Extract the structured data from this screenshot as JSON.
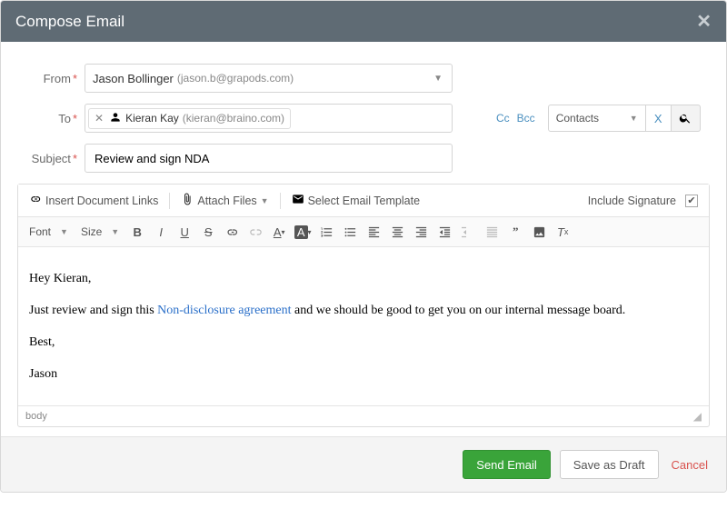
{
  "header": {
    "title": "Compose Email"
  },
  "labels": {
    "from": "From",
    "to": "To",
    "subject": "Subject"
  },
  "from": {
    "name": "Jason Bollinger",
    "email": "(jason.b@grapods.com)"
  },
  "to": {
    "chips": [
      {
        "name": "Kieran Kay",
        "email": "(kieran@braino.com)"
      }
    ],
    "cc_label": "Cc",
    "bcc_label": "Bcc",
    "contacts_label": "Contacts"
  },
  "subject": {
    "value": "Review and sign NDA"
  },
  "toolbar1": {
    "insert_links": "Insert Document Links",
    "attach_files": "Attach Files",
    "select_template": "Select Email Template",
    "include_signature": "Include Signature",
    "signature_checked": true
  },
  "toolbar2": {
    "font_label": "Font",
    "size_label": "Size"
  },
  "body": {
    "greeting": "Hey Kieran,",
    "line1_pre": "Just review and sign this ",
    "line1_link": "Non-disclosure agreement",
    "line1_post": " and we should be good to get you on our internal message board.",
    "signoff": "Best,",
    "name": "Jason"
  },
  "editor_footer": {
    "path": "body"
  },
  "footer": {
    "send": "Send Email",
    "draft": "Save as Draft",
    "cancel": "Cancel"
  }
}
